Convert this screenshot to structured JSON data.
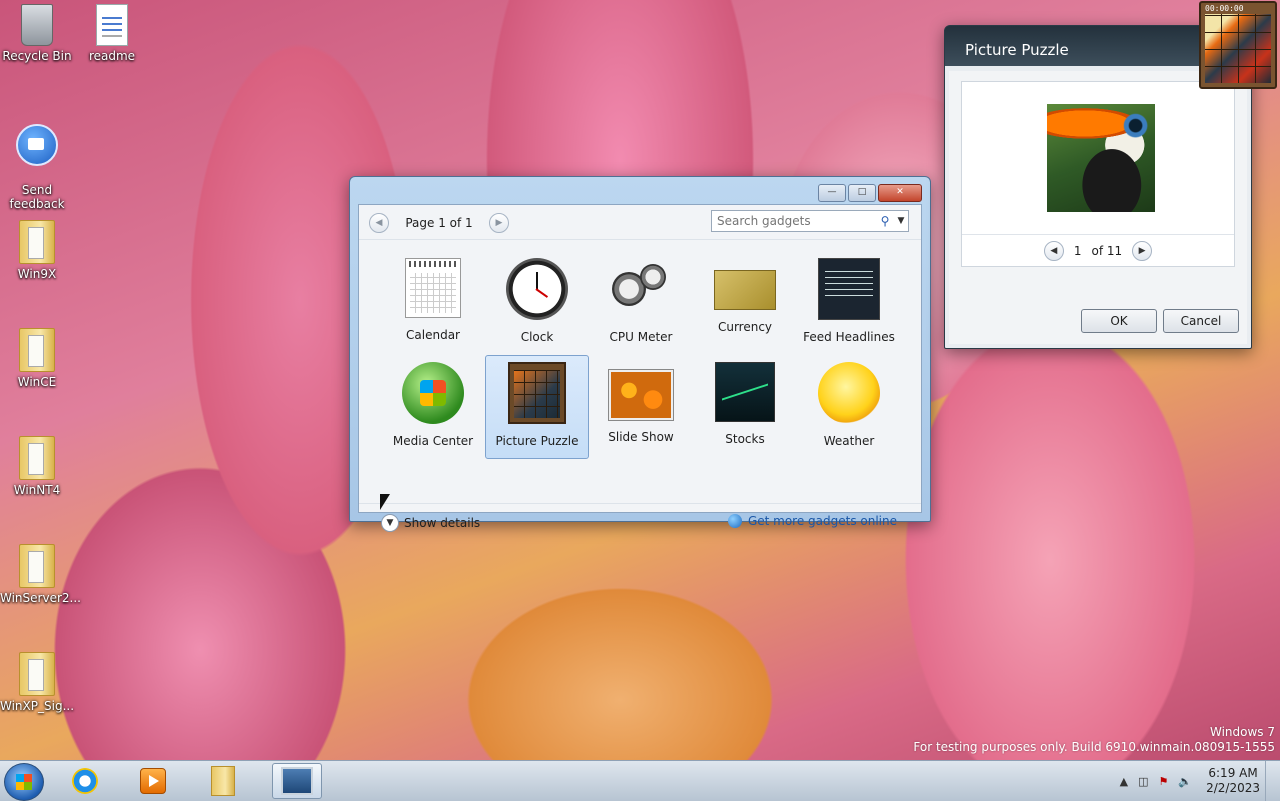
{
  "desktop": {
    "icons": [
      {
        "label": "Recycle Bin",
        "icon": "recycle-bin-icon"
      },
      {
        "label": "readme",
        "icon": "document-icon"
      },
      {
        "label": "Send\nfeedback",
        "icon": "feedback-icon"
      },
      {
        "label": "Win9X",
        "icon": "folder-icon"
      },
      {
        "label": "WinCE",
        "icon": "folder-icon"
      },
      {
        "label": "WinNT4",
        "icon": "folder-icon"
      },
      {
        "label": "WinServer2...",
        "icon": "folder-icon"
      },
      {
        "label": "WinXP_Sig...",
        "icon": "folder-icon"
      }
    ]
  },
  "gallery": {
    "pager_label": "Page 1 of 1",
    "search_placeholder": "Search gadgets",
    "gadgets": [
      {
        "label": "Calendar",
        "icon": "calendar-icon",
        "calendar_month": "OCT 06"
      },
      {
        "label": "Clock",
        "icon": "clock-icon"
      },
      {
        "label": "CPU Meter",
        "icon": "cpu-meter-icon"
      },
      {
        "label": "Currency",
        "icon": "currency-icon"
      },
      {
        "label": "Feed Headlines",
        "icon": "feed-icon"
      },
      {
        "label": "Media Center",
        "icon": "media-center-icon"
      },
      {
        "label": "Picture Puzzle",
        "icon": "picture-puzzle-icon",
        "selected": true
      },
      {
        "label": "Slide Show",
        "icon": "slide-show-icon"
      },
      {
        "label": "Stocks",
        "icon": "stocks-icon"
      },
      {
        "label": "Weather",
        "icon": "weather-icon"
      }
    ],
    "show_details_label": "Show details",
    "more_gadgets_label": "Get more gadgets online"
  },
  "picture_puzzle_settings": {
    "title": "Picture Puzzle",
    "current_picture": "1",
    "of_label": "of 11",
    "ok_label": "OK",
    "cancel_label": "Cancel"
  },
  "puzzle_gadget": {
    "timer": "00:00:00"
  },
  "watermark": {
    "line1": "Windows 7",
    "line2": "For testing purposes only. Build 6910.winmain.080915-1555"
  },
  "taskbar": {
    "apps": [
      "internet-explorer-icon",
      "media-player-icon",
      "explorer-icon",
      "gadget-gallery-icon"
    ],
    "clock_time": "6:19 AM",
    "clock_date": "2/2/2023"
  },
  "colors": {
    "selection_bg": "#c5ddf7",
    "link": "#1a56a6",
    "close_button": "#c3452c"
  }
}
